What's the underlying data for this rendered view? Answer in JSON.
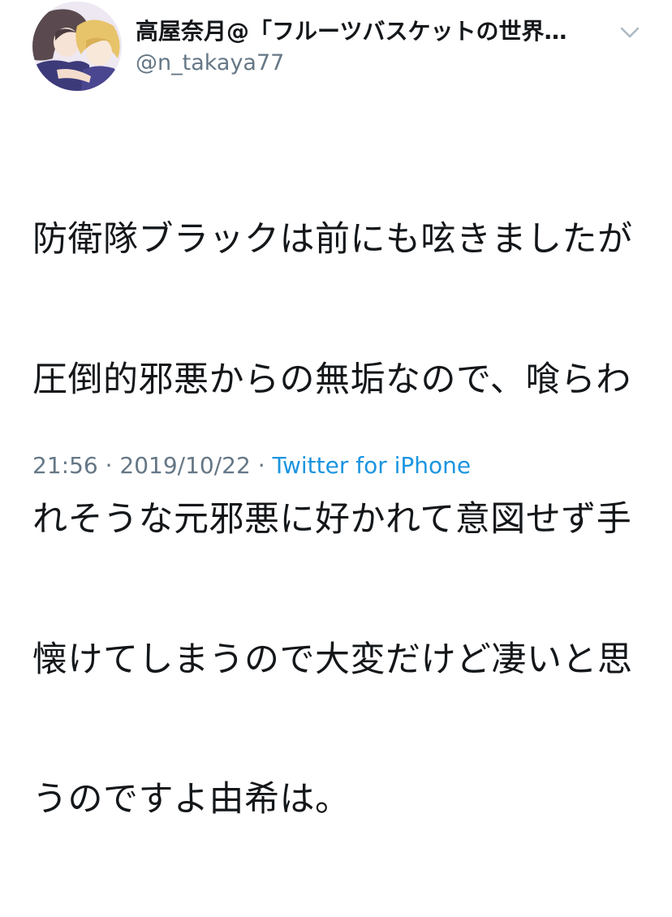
{
  "author": {
    "display_name": "高屋奈月@「フルーツバスケットの世界…",
    "handle": "@n_takaya77",
    "avatar_icon": "avatar-illustration-icon"
  },
  "menu": {
    "icon": "chevron-down-icon",
    "color": "#aab8c2"
  },
  "tweet": {
    "lines": [
      "防衛隊ブラックは前にも呟きましたが",
      "圧倒的邪悪からの無垢なので、喰らわ",
      "れそうな元邪悪に好かれて意図せず手",
      "懐けてしまうので大変だけど凄いと思",
      "うのですよ由希は。"
    ]
  },
  "meta": {
    "time": "21:56",
    "separator": " · ",
    "date": "2019/10/22",
    "source": "Twitter for iPhone"
  },
  "colors": {
    "text": "#14171a",
    "secondary": "#657786",
    "link": "#1b95e0"
  }
}
